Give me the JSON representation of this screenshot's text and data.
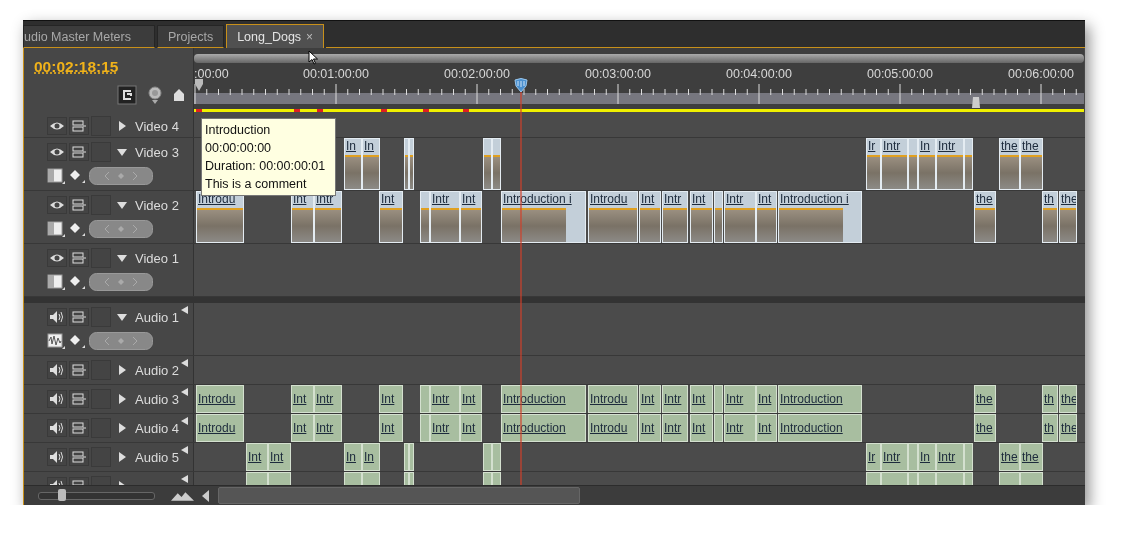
{
  "tabs": [
    {
      "label": "udio Master Meters",
      "selected": false
    },
    {
      "label": "Projects",
      "selected": false
    },
    {
      "label": "Long_Dogs",
      "selected": true,
      "close_glyph": "×"
    }
  ],
  "timecode": "00:02:18:15",
  "ruler": {
    "labels": [
      ":00:00",
      "00:01:00:00",
      "00:02:00:00",
      "00:03:00:00",
      "00:04:00:00",
      "00:05:00:00",
      "00:06:00:00"
    ]
  },
  "tooltip": {
    "lines": [
      "Introduction",
      "00:00:00:00",
      "Duration: 00:00:00:01",
      "This is a comment"
    ]
  },
  "tracks": [
    {
      "name": "Video 4",
      "kind": "video",
      "expanded": false
    },
    {
      "name": "Video 3",
      "kind": "video",
      "expanded": true,
      "clips": [
        {
          "kind": "titled",
          "label": "In"
        },
        {
          "kind": "titled",
          "label": "In"
        },
        {
          "kind": "blank"
        },
        {
          "kind": "blank"
        },
        {
          "kind": "blank"
        },
        {
          "kind": "blank"
        },
        {
          "kind": "titled",
          "label": "Ir"
        },
        {
          "kind": "titled",
          "label": "Intr"
        },
        {
          "kind": "blank"
        },
        {
          "kind": "titled",
          "label": "In"
        },
        {
          "kind": "titled",
          "label": "Intr"
        },
        {
          "kind": "blank"
        },
        {
          "kind": "titled",
          "label": "the"
        },
        {
          "kind": "titled",
          "label": "the"
        }
      ]
    },
    {
      "name": "Video 2",
      "kind": "video",
      "expanded": true,
      "clips": [
        {
          "kind": "titled",
          "label": "Introdu"
        },
        {
          "kind": "titled",
          "label": "Int"
        },
        {
          "kind": "titled",
          "label": "Intr"
        },
        {
          "kind": "titled",
          "label": "Int"
        },
        {
          "kind": "blank"
        },
        {
          "kind": "titled",
          "label": "Intr"
        },
        {
          "kind": "titled",
          "label": "Int"
        },
        {
          "kind": "titled",
          "label": "Introduction i"
        },
        {
          "kind": "titled",
          "label": "Introdu"
        },
        {
          "kind": "titled",
          "label": "Int"
        },
        {
          "kind": "titled",
          "label": "Intr"
        },
        {
          "kind": "titled",
          "label": "Int"
        },
        {
          "kind": "blank"
        },
        {
          "kind": "titled",
          "label": "Intr"
        },
        {
          "kind": "titled",
          "label": "Int"
        },
        {
          "kind": "titled",
          "label": "Introduction i"
        },
        {
          "kind": "titled",
          "label": "the"
        },
        {
          "kind": "titled",
          "label": "th"
        },
        {
          "kind": "titled",
          "label": "the"
        }
      ]
    },
    {
      "name": "Video 1",
      "kind": "video",
      "expanded": true
    },
    {
      "name": "Audio 1",
      "kind": "audio",
      "expanded": true
    },
    {
      "name": "Audio 2",
      "kind": "audio",
      "expanded": false
    },
    {
      "name": "Audio 3",
      "kind": "audio",
      "expanded": false,
      "clips": [
        {
          "kind": "titled",
          "label": "Introdu"
        },
        {
          "kind": "titled",
          "label": "Int"
        },
        {
          "kind": "titled",
          "label": "Intr"
        },
        {
          "kind": "titled",
          "label": "Int"
        },
        {
          "kind": "blank"
        },
        {
          "kind": "titled",
          "label": "Intr"
        },
        {
          "kind": "titled",
          "label": "Int"
        },
        {
          "kind": "titled",
          "label": "Introduction"
        },
        {
          "kind": "titled",
          "label": "Introdu"
        },
        {
          "kind": "titled",
          "label": "Int"
        },
        {
          "kind": "titled",
          "label": "Intr"
        },
        {
          "kind": "titled",
          "label": "Int"
        },
        {
          "kind": "blank"
        },
        {
          "kind": "titled",
          "label": "Intr"
        },
        {
          "kind": "titled",
          "label": "Int"
        },
        {
          "kind": "titled",
          "label": "Introduction"
        },
        {
          "kind": "titled",
          "label": "the"
        },
        {
          "kind": "titled",
          "label": "th"
        },
        {
          "kind": "titled",
          "label": "the"
        }
      ]
    },
    {
      "name": "Audio 4",
      "kind": "audio",
      "expanded": false,
      "clips": [
        {
          "kind": "titled",
          "label": "Introdu"
        },
        {
          "kind": "titled",
          "label": "Int"
        },
        {
          "kind": "titled",
          "label": "Intr"
        },
        {
          "kind": "titled",
          "label": "Int"
        },
        {
          "kind": "blank"
        },
        {
          "kind": "titled",
          "label": "Intr"
        },
        {
          "kind": "titled",
          "label": "Int"
        },
        {
          "kind": "titled",
          "label": "Introduction"
        },
        {
          "kind": "titled",
          "label": "Introdu"
        },
        {
          "kind": "titled",
          "label": "Int"
        },
        {
          "kind": "titled",
          "label": "Intr"
        },
        {
          "kind": "titled",
          "label": "Int"
        },
        {
          "kind": "blank"
        },
        {
          "kind": "titled",
          "label": "Intr"
        },
        {
          "kind": "titled",
          "label": "Int"
        },
        {
          "kind": "titled",
          "label": "Introduction"
        },
        {
          "kind": "titled",
          "label": "the"
        },
        {
          "kind": "titled",
          "label": "th"
        },
        {
          "kind": "titled",
          "label": "the"
        }
      ]
    },
    {
      "name": "Audio 5",
      "kind": "audio",
      "expanded": false,
      "clips": [
        {
          "kind": "titled",
          "label": "Int"
        },
        {
          "kind": "titled",
          "label": "Int"
        },
        {
          "kind": "titled",
          "label": "In"
        },
        {
          "kind": "titled",
          "label": "In"
        },
        {
          "kind": "blank"
        },
        {
          "kind": "blank"
        },
        {
          "kind": "blank"
        },
        {
          "kind": "blank"
        },
        {
          "kind": "titled",
          "label": "Ir"
        },
        {
          "kind": "titled",
          "label": "Intr"
        },
        {
          "kind": "blank"
        },
        {
          "kind": "titled",
          "label": "In"
        },
        {
          "kind": "titled",
          "label": "Intr"
        },
        {
          "kind": "blank"
        },
        {
          "kind": "titled",
          "label": "the"
        },
        {
          "kind": "titled",
          "label": "the"
        }
      ]
    },
    {
      "kind": "audio",
      "expanded": false,
      "clips": [
        {
          "kind": "blank"
        },
        {
          "kind": "blank"
        },
        {
          "kind": "blank"
        },
        {
          "kind": "blank"
        },
        {
          "kind": "blank"
        },
        {
          "kind": "blank"
        },
        {
          "kind": "blank"
        },
        {
          "kind": "blank"
        },
        {
          "kind": "blank"
        },
        {
          "kind": "blank"
        },
        {
          "kind": "blank"
        },
        {
          "kind": "blank"
        },
        {
          "kind": "blank"
        },
        {
          "kind": "blank"
        },
        {
          "kind": "blank"
        },
        {
          "kind": "blank"
        }
      ]
    }
  ],
  "zoom_slider": {
    "level": 0.2
  }
}
